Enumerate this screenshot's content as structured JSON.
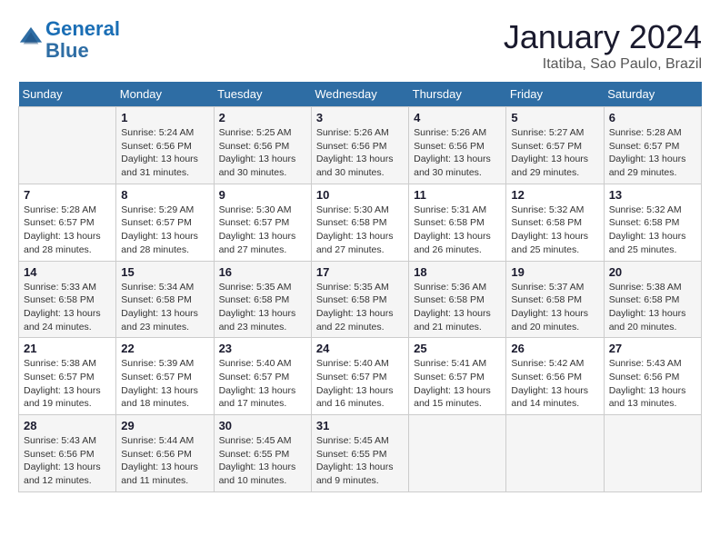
{
  "header": {
    "logo_line1": "General",
    "logo_line2": "Blue",
    "month": "January 2024",
    "location": "Itatiba, Sao Paulo, Brazil"
  },
  "days_of_week": [
    "Sunday",
    "Monday",
    "Tuesday",
    "Wednesday",
    "Thursday",
    "Friday",
    "Saturday"
  ],
  "weeks": [
    [
      {
        "day": "",
        "info": ""
      },
      {
        "day": "1",
        "info": "Sunrise: 5:24 AM\nSunset: 6:56 PM\nDaylight: 13 hours\nand 31 minutes."
      },
      {
        "day": "2",
        "info": "Sunrise: 5:25 AM\nSunset: 6:56 PM\nDaylight: 13 hours\nand 30 minutes."
      },
      {
        "day": "3",
        "info": "Sunrise: 5:26 AM\nSunset: 6:56 PM\nDaylight: 13 hours\nand 30 minutes."
      },
      {
        "day": "4",
        "info": "Sunrise: 5:26 AM\nSunset: 6:56 PM\nDaylight: 13 hours\nand 30 minutes."
      },
      {
        "day": "5",
        "info": "Sunrise: 5:27 AM\nSunset: 6:57 PM\nDaylight: 13 hours\nand 29 minutes."
      },
      {
        "day": "6",
        "info": "Sunrise: 5:28 AM\nSunset: 6:57 PM\nDaylight: 13 hours\nand 29 minutes."
      }
    ],
    [
      {
        "day": "7",
        "info": "Sunrise: 5:28 AM\nSunset: 6:57 PM\nDaylight: 13 hours\nand 28 minutes."
      },
      {
        "day": "8",
        "info": "Sunrise: 5:29 AM\nSunset: 6:57 PM\nDaylight: 13 hours\nand 28 minutes."
      },
      {
        "day": "9",
        "info": "Sunrise: 5:30 AM\nSunset: 6:57 PM\nDaylight: 13 hours\nand 27 minutes."
      },
      {
        "day": "10",
        "info": "Sunrise: 5:30 AM\nSunset: 6:58 PM\nDaylight: 13 hours\nand 27 minutes."
      },
      {
        "day": "11",
        "info": "Sunrise: 5:31 AM\nSunset: 6:58 PM\nDaylight: 13 hours\nand 26 minutes."
      },
      {
        "day": "12",
        "info": "Sunrise: 5:32 AM\nSunset: 6:58 PM\nDaylight: 13 hours\nand 25 minutes."
      },
      {
        "day": "13",
        "info": "Sunrise: 5:32 AM\nSunset: 6:58 PM\nDaylight: 13 hours\nand 25 minutes."
      }
    ],
    [
      {
        "day": "14",
        "info": "Sunrise: 5:33 AM\nSunset: 6:58 PM\nDaylight: 13 hours\nand 24 minutes."
      },
      {
        "day": "15",
        "info": "Sunrise: 5:34 AM\nSunset: 6:58 PM\nDaylight: 13 hours\nand 23 minutes."
      },
      {
        "day": "16",
        "info": "Sunrise: 5:35 AM\nSunset: 6:58 PM\nDaylight: 13 hours\nand 23 minutes."
      },
      {
        "day": "17",
        "info": "Sunrise: 5:35 AM\nSunset: 6:58 PM\nDaylight: 13 hours\nand 22 minutes."
      },
      {
        "day": "18",
        "info": "Sunrise: 5:36 AM\nSunset: 6:58 PM\nDaylight: 13 hours\nand 21 minutes."
      },
      {
        "day": "19",
        "info": "Sunrise: 5:37 AM\nSunset: 6:58 PM\nDaylight: 13 hours\nand 20 minutes."
      },
      {
        "day": "20",
        "info": "Sunrise: 5:38 AM\nSunset: 6:58 PM\nDaylight: 13 hours\nand 20 minutes."
      }
    ],
    [
      {
        "day": "21",
        "info": "Sunrise: 5:38 AM\nSunset: 6:57 PM\nDaylight: 13 hours\nand 19 minutes."
      },
      {
        "day": "22",
        "info": "Sunrise: 5:39 AM\nSunset: 6:57 PM\nDaylight: 13 hours\nand 18 minutes."
      },
      {
        "day": "23",
        "info": "Sunrise: 5:40 AM\nSunset: 6:57 PM\nDaylight: 13 hours\nand 17 minutes."
      },
      {
        "day": "24",
        "info": "Sunrise: 5:40 AM\nSunset: 6:57 PM\nDaylight: 13 hours\nand 16 minutes."
      },
      {
        "day": "25",
        "info": "Sunrise: 5:41 AM\nSunset: 6:57 PM\nDaylight: 13 hours\nand 15 minutes."
      },
      {
        "day": "26",
        "info": "Sunrise: 5:42 AM\nSunset: 6:56 PM\nDaylight: 13 hours\nand 14 minutes."
      },
      {
        "day": "27",
        "info": "Sunrise: 5:43 AM\nSunset: 6:56 PM\nDaylight: 13 hours\nand 13 minutes."
      }
    ],
    [
      {
        "day": "28",
        "info": "Sunrise: 5:43 AM\nSunset: 6:56 PM\nDaylight: 13 hours\nand 12 minutes."
      },
      {
        "day": "29",
        "info": "Sunrise: 5:44 AM\nSunset: 6:56 PM\nDaylight: 13 hours\nand 11 minutes."
      },
      {
        "day": "30",
        "info": "Sunrise: 5:45 AM\nSunset: 6:55 PM\nDaylight: 13 hours\nand 10 minutes."
      },
      {
        "day": "31",
        "info": "Sunrise: 5:45 AM\nSunset: 6:55 PM\nDaylight: 13 hours\nand 9 minutes."
      },
      {
        "day": "",
        "info": ""
      },
      {
        "day": "",
        "info": ""
      },
      {
        "day": "",
        "info": ""
      }
    ]
  ]
}
